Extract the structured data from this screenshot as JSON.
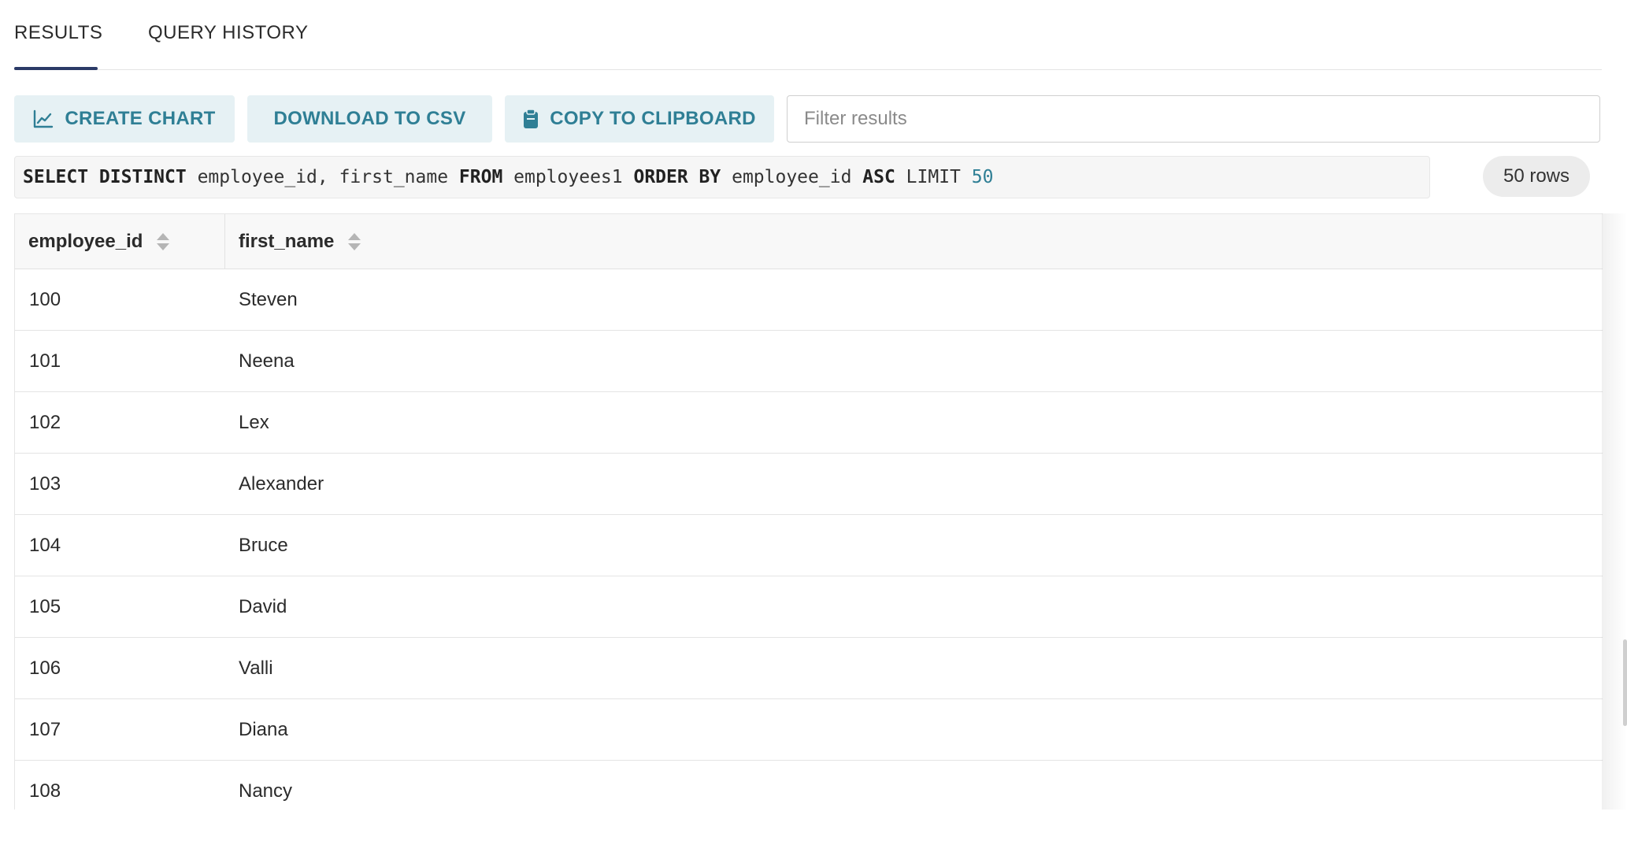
{
  "tabs": [
    {
      "label": "RESULTS",
      "active": true
    },
    {
      "label": "QUERY HISTORY",
      "active": false
    }
  ],
  "toolbar": {
    "create_chart_label": "CREATE CHART",
    "download_csv_label": "DOWNLOAD TO CSV",
    "copy_clipboard_label": "COPY TO CLIPBOARD",
    "filter_placeholder": "Filter results",
    "filter_value": ""
  },
  "query": {
    "parts": [
      {
        "text": "SELECT DISTINCT",
        "kind": "keyword"
      },
      {
        "text": " employee_id, first_name ",
        "kind": "plain"
      },
      {
        "text": "FROM",
        "kind": "keyword"
      },
      {
        "text": " employees1 ",
        "kind": "plain"
      },
      {
        "text": "ORDER BY",
        "kind": "keyword"
      },
      {
        "text": " employee_id ",
        "kind": "plain"
      },
      {
        "text": "ASC",
        "kind": "keyword"
      },
      {
        "text": " LIMIT ",
        "kind": "plain"
      },
      {
        "text": "50",
        "kind": "number"
      }
    ],
    "row_count_label": "50 rows"
  },
  "table": {
    "columns": [
      {
        "label": "employee_id"
      },
      {
        "label": "first_name"
      }
    ],
    "rows": [
      {
        "employee_id": "100",
        "first_name": "Steven"
      },
      {
        "employee_id": "101",
        "first_name": "Neena"
      },
      {
        "employee_id": "102",
        "first_name": "Lex"
      },
      {
        "employee_id": "103",
        "first_name": "Alexander"
      },
      {
        "employee_id": "104",
        "first_name": "Bruce"
      },
      {
        "employee_id": "105",
        "first_name": "David"
      },
      {
        "employee_id": "106",
        "first_name": "Valli"
      },
      {
        "employee_id": "107",
        "first_name": "Diana"
      },
      {
        "employee_id": "108",
        "first_name": "Nancy"
      }
    ]
  },
  "icons": {
    "create_chart": "line-chart-icon",
    "copy_clipboard": "clipboard-icon",
    "sort": "sort-icon"
  },
  "colors": {
    "accent": "#2f7f95",
    "button_bg": "#e6f1f4",
    "tab_underline": "#2b3a67"
  }
}
